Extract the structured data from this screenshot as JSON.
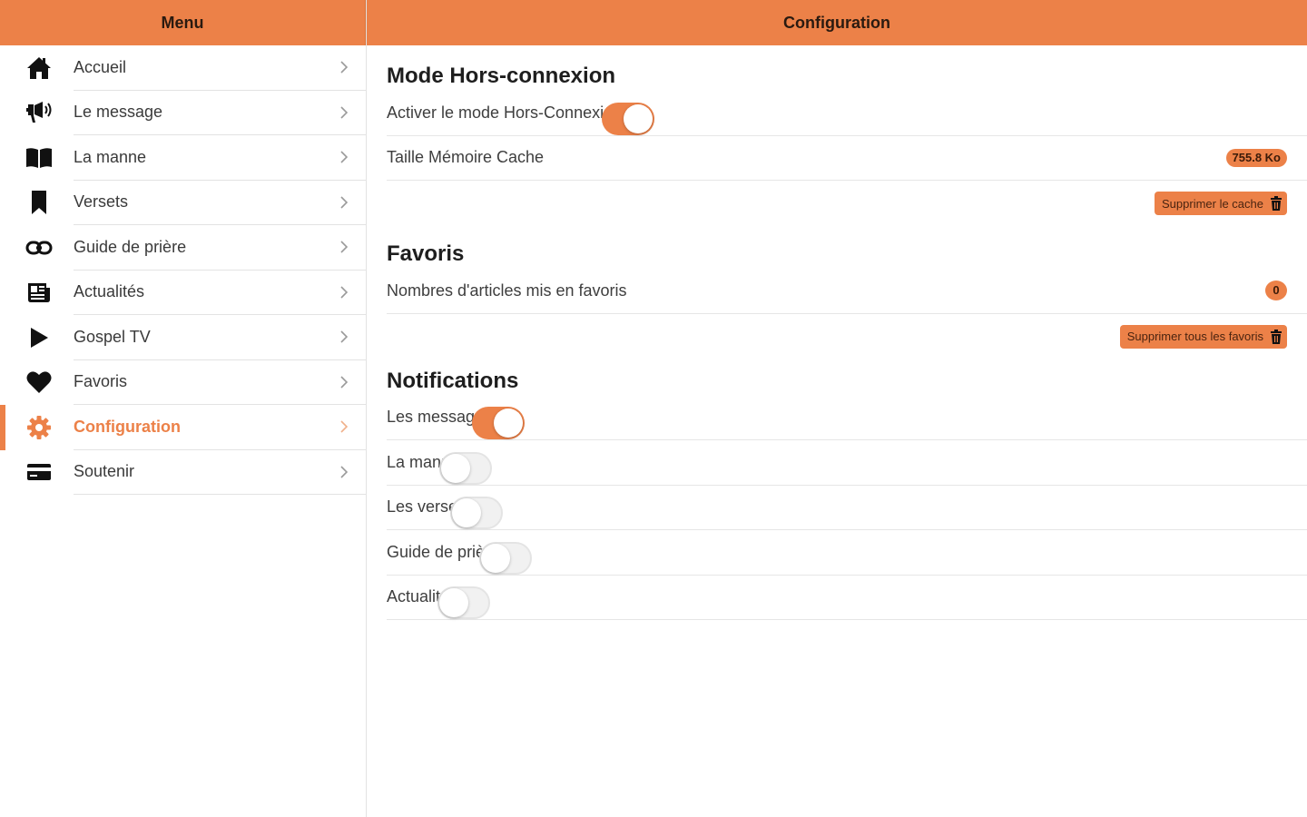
{
  "colors": {
    "accent": "#ec8148",
    "text": "#3a3a3a",
    "divider": "#e3e3e3"
  },
  "sidebar": {
    "title": "Menu",
    "items": [
      {
        "label": "Accueil",
        "icon": "home-icon"
      },
      {
        "label": "Le message",
        "icon": "megaphone-icon"
      },
      {
        "label": "La manne",
        "icon": "book-icon"
      },
      {
        "label": "Versets",
        "icon": "bookmark-icon"
      },
      {
        "label": "Guide de prière",
        "icon": "link-icon"
      },
      {
        "label": "Actualités",
        "icon": "newspaper-icon"
      },
      {
        "label": "Gospel TV",
        "icon": "play-icon"
      },
      {
        "label": "Favoris",
        "icon": "heart-icon"
      },
      {
        "label": "Configuration",
        "icon": "gear-icon",
        "active": true
      },
      {
        "label": "Soutenir",
        "icon": "credit-card-icon"
      }
    ]
  },
  "main": {
    "title": "Configuration",
    "offline": {
      "title": "Mode Hors-connexion",
      "enable_label": "Activer le mode Hors-Connexion",
      "enable_on": true,
      "cache_label": "Taille Mémoire Cache",
      "cache_value": "755.8 Ko",
      "clear_cache_label": "Supprimer le cache"
    },
    "favorites": {
      "title": "Favoris",
      "count_label": "Nombres d'articles mis en favoris",
      "count_value": "0",
      "clear_label": "Supprimer tous les favoris"
    },
    "notifications": {
      "title": "Notifications",
      "items": [
        {
          "label": "Les messages",
          "on": true
        },
        {
          "label": "La manne",
          "on": false
        },
        {
          "label": "Les versets",
          "on": false
        },
        {
          "label": "Guide de prière",
          "on": false
        },
        {
          "label": "Actualités",
          "on": false
        }
      ]
    }
  }
}
